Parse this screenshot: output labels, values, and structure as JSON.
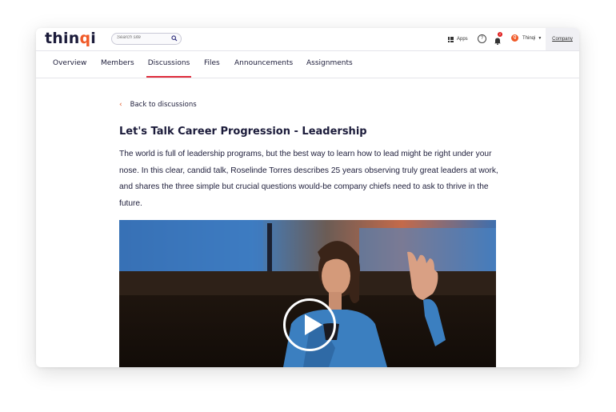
{
  "header": {
    "logo_prefix": "thin",
    "logo_accent": "q",
    "logo_suffix": "i",
    "search_placeholder": "Search site",
    "apps_label": "Apps",
    "help_label": "?",
    "notification_count": "2",
    "user_initial": "Q",
    "user_name": "Thinqi",
    "company_label": "Company"
  },
  "nav": {
    "tabs": [
      {
        "label": "Overview"
      },
      {
        "label": "Members"
      },
      {
        "label": "Discussions",
        "active": true
      },
      {
        "label": "Files"
      },
      {
        "label": "Announcements"
      },
      {
        "label": "Assignments"
      }
    ]
  },
  "main": {
    "back_label": "Back to discussions",
    "back_icon": "chevron-left-icon",
    "title": "Let's Talk Career Progression - Leadership",
    "description": "The world is full of leadership programs, but the best way to learn how to lead might be right under your nose. In this clear, candid talk, Roselinde Torres describes 25 years observing truly great leaders at work, and shares the three simple but crucial questions would-be company chiefs need to ask to thrive in the future.",
    "video": {
      "play_icon": "play-icon"
    }
  },
  "colors": {
    "accent": "#f05a28",
    "active_tab_underline": "#e02d3c",
    "text": "#1d1d3a"
  }
}
